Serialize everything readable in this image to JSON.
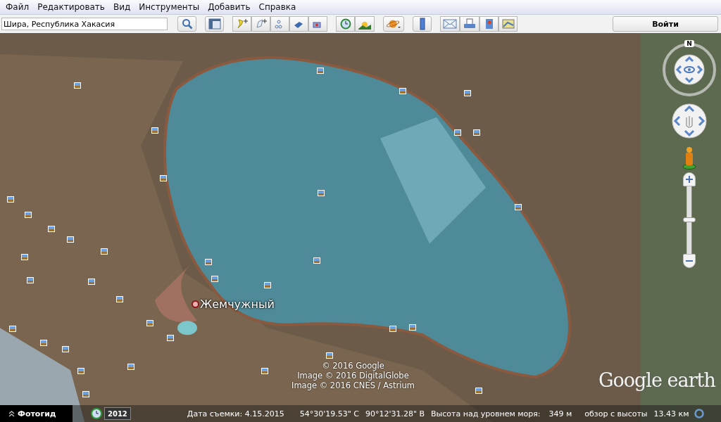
{
  "menu": [
    "Файл",
    "Редактировать",
    "Вид",
    "Инструменты",
    "Добавить",
    "Справка"
  ],
  "search": {
    "value": "Шира, Республика Хакасия"
  },
  "login_button": "Войти",
  "map": {
    "place_label": "Жемчужный",
    "copyright": [
      "© 2016 Google",
      "Image © 2016 DigitalGlobe",
      "Image © 2016 CNES / Astrium"
    ],
    "logo": "Google earth",
    "compass_north": "N",
    "zoom_slider": {
      "level": 0.5
    }
  },
  "status_bar": {
    "photo_guide": "Фотогид",
    "year": "2012",
    "imagery_date": "Дата съемки: 4.15.2015",
    "latitude": "54°30'19.53\" С",
    "longitude": "90°12'31.28\" В",
    "elevation_label": "Высота над уровнем моря:",
    "elevation": "349 м",
    "eye_alt_label": "обзор с высоты",
    "eye_alt": "13.43 км"
  }
}
